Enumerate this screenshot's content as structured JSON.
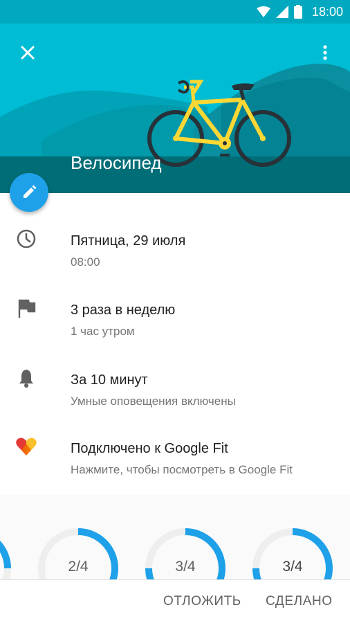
{
  "status_bar": {
    "time": "18:00"
  },
  "hero": {
    "title": "Велосипед"
  },
  "details": [
    {
      "icon": "clock-icon",
      "primary": "Пятница, 29 июля",
      "secondary": "08:00"
    },
    {
      "icon": "flag-icon",
      "primary": "3 раза в неделю",
      "secondary": "1 час утром"
    },
    {
      "icon": "bell-icon",
      "primary": "За 10 минут",
      "secondary": "Умные оповещения включены"
    },
    {
      "icon": "google-fit-heart-icon",
      "primary": "Подключено к Google Fit",
      "secondary": "Нажмите, чтобы посмотреть в Google Fit"
    }
  ],
  "progress": [
    {
      "label": "",
      "fraction": 0.25
    },
    {
      "label": "2/4",
      "fraction": 0.5
    },
    {
      "label": "3/4",
      "fraction": 0.75
    },
    {
      "label": "3/4",
      "fraction": 0.75
    }
  ],
  "actions": {
    "snooze": "ОТЛОЖИТЬ",
    "done": "СДЕЛАНО"
  },
  "colors": {
    "accent": "#1ea1e9",
    "header": "#00bcd4",
    "status_bar": "#00a9bf"
  }
}
